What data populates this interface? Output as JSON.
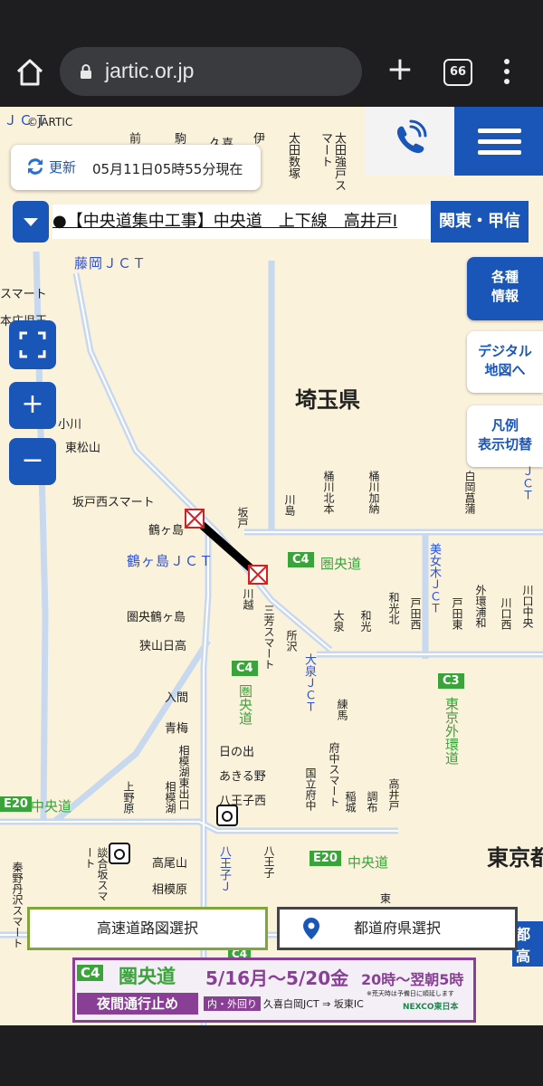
{
  "browser": {
    "url": "jartic.or.jp",
    "tab_count": "66"
  },
  "map": {
    "copyright": "©JARTIC",
    "top_jct": "ＪＣＴ",
    "update_label": "更新",
    "update_time": "05月11日05時55分現在",
    "news_ticker": "●【中央道集中工事】中央道　上下線　高井戸I",
    "region_button": "関東・甲信",
    "side_buttons": {
      "info": "各種\n情報",
      "digital_map": "デジタル\n地図へ",
      "legend": "凡例\n表示切替"
    },
    "zoom_in": "+",
    "zoom_out": "−",
    "prefecture_labels": {
      "saitama": "埼玉県",
      "tokyo": "東京都"
    },
    "jct_labels": {
      "fujioka": "藤岡ＪＣＴ",
      "tsurugashima": "鶴ヶ島ＪＣＴ",
      "ooizumi": "大泉ＪＣＴ",
      "bijogi": "美女木ＪＣＴ",
      "hachioji": "八王子Ｊ",
      "right_top": "ＪＣＴ"
    },
    "route_labels": {
      "c4_top": "C4",
      "c4_top_name": "圏央道",
      "c4_mid": "C4",
      "c4_mid_name": "圏央道",
      "c3": "C3",
      "c3_name": "東京外環道",
      "e20_left": "E20",
      "e20_left_name": "中央道",
      "e20_right": "E20",
      "e20_right_name": "中央道",
      "c4_bottom": "C4",
      "shutoko": "都高"
    },
    "ic_labels": {
      "sukagawa": "小川",
      "higashimatsuyama": "東松山",
      "sakadonishi": "坂戸西スマート",
      "tsurugashima_ic": "鶴ヶ島",
      "kenou_tsurugashima": "圏央鶴ヶ島",
      "sayama_hidaka": "狭山日高",
      "iruma": "入間",
      "oume": "青梅",
      "hinode": "日の出",
      "akiruno": "あきる野",
      "hachioji_nishi": "八王子西",
      "takaozan": "高尾山",
      "sagamihara": "相模原",
      "sagamiko_higashi": "相模湖東出口",
      "sagamiko": "相模湖",
      "uenohara": "上野原",
      "dangozaka": "談合坂スマート",
      "hadano": "秦野丹沢スマート",
      "sakado": "坂戸",
      "kawajima": "川島",
      "kawagoe": "川越",
      "miyoshi": "三芳スマート",
      "tokorozawa": "所沢",
      "oizumi": "大泉",
      "nerima": "練馬",
      "wako": "和光",
      "wakokita": "和光北",
      "toda_nishi": "戸田西",
      "toda_higashi": "戸田東",
      "gaikan_urawa": "外環浦和",
      "kawaguchi_chuo": "川口中央",
      "kawaguchi_nishi": "川口西",
      "fuchu_smart": "府中スマート",
      "kunitachi": "国立府中",
      "inagi": "稲城",
      "chofu": "調布",
      "takaido": "高井戸",
      "hachioji_ic": "八王子",
      "okegawa_kita": "桶川北本",
      "okegawa_kano": "桶川加納",
      "shiraoka": "白岡菖蒲",
      "top_row": [
        "前",
        "駒",
        "久喜",
        "伊",
        "太田数塚",
        "太田強戸スマート"
      ],
      "left_stub1": "スマート",
      "left_stub2": "本庄児玉",
      "higashi": "東"
    },
    "bottom_buttons": {
      "highway": "高速道路図選択",
      "prefecture": "都道府県選択"
    },
    "banner": {
      "route_code": "C4",
      "route_name": "圏央道",
      "subtitle": "夜間通行止め",
      "dates": "5/16月～5/20金",
      "times": "20時～翌朝5時",
      "direction": "内・外回り",
      "section": "久喜白岡JCT ⇒ 坂東IC",
      "note": "※荒天時は予備日に順延します",
      "company": "NEXCO東日本"
    },
    "colors": {
      "map_bg": "#fbf2dc",
      "road_highway": "#c8d8ef",
      "accent_blue": "#1a55b8",
      "route_green": "#3aa33a",
      "jct_blue": "#2a50d8",
      "banner_purple": "#8a3f96"
    }
  }
}
